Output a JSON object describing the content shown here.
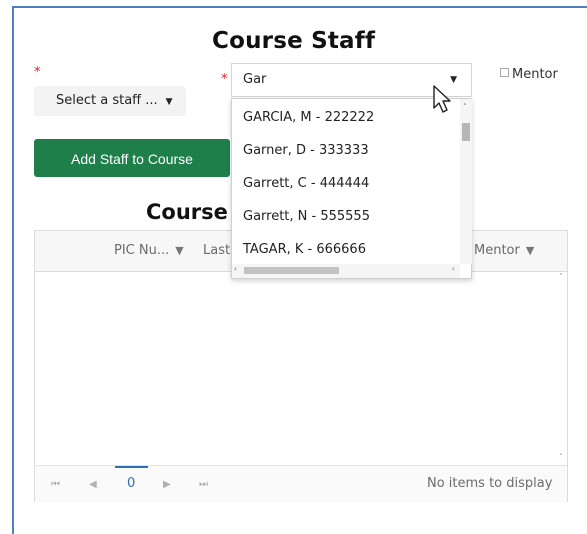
{
  "page": {
    "title": "Course Staff",
    "subtitle": "Course",
    "required_marker": "*"
  },
  "staff_select": {
    "value": "Select a staff ...",
    "caret": "▼"
  },
  "role_combo": {
    "value": "Gar",
    "caret": "▼"
  },
  "mentor_checkbox": {
    "label": "Mentor",
    "checked": false
  },
  "add_button": {
    "label": "Add Staff to Course",
    "color": "#1e7f4a"
  },
  "dropdown": {
    "options": [
      "GARCIA, M - 222222",
      "Garner, D - 333333",
      "Garrett, C - 444444",
      "Garrett, N - 555555",
      "TAGAR, K - 666666"
    ],
    "scroll_up": "˄",
    "scroll_left": "‹",
    "scroll_right": "›"
  },
  "grid": {
    "columns": [
      {
        "label": "PIC Nu...",
        "filter": "▼"
      },
      {
        "label": "Last",
        "filter": ""
      },
      {
        "label": "Mentor",
        "filter": "▼"
      }
    ],
    "pager": {
      "first": "⏮",
      "prev": "◀",
      "page": "0",
      "next": "▶",
      "last": "⏭",
      "status": "No items to display"
    },
    "scroll_up": "˄",
    "scroll_down": "˅"
  }
}
